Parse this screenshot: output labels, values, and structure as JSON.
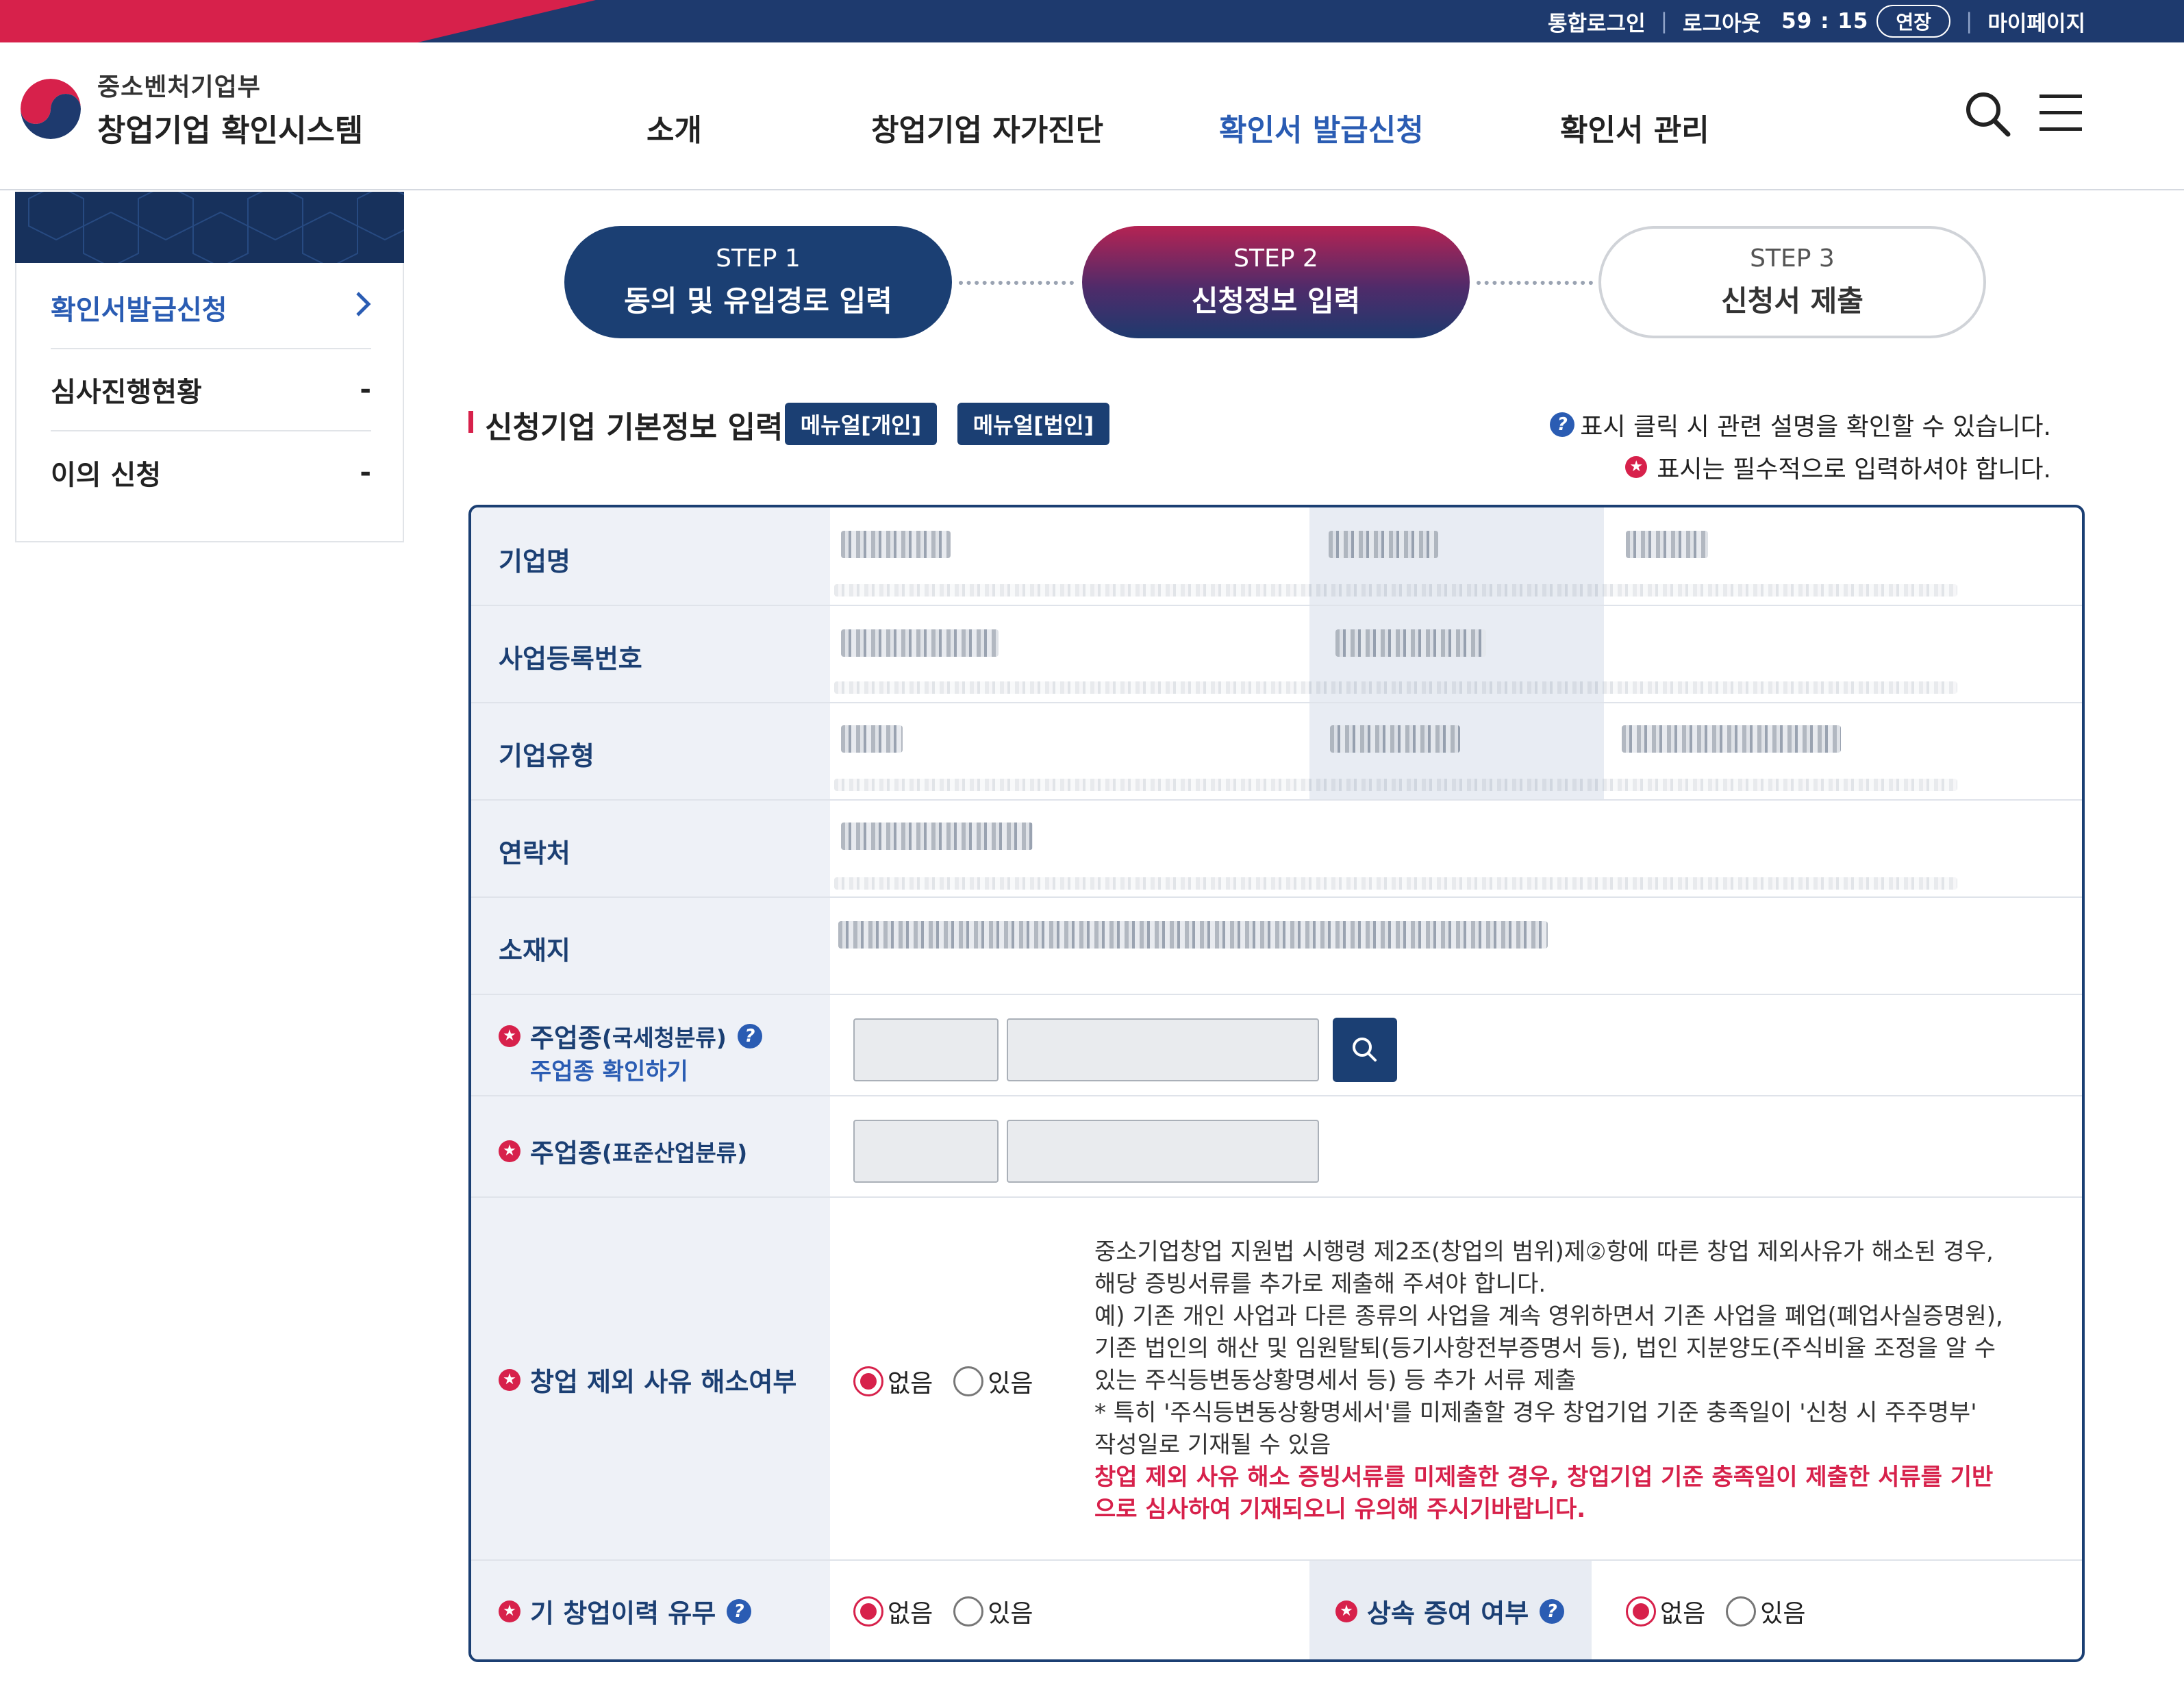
{
  "topbar": {
    "integrated_login": "통합로그인",
    "logout": "로그아웃",
    "timer": "59 : 15",
    "extend": "연장",
    "mypage": "마이페이지"
  },
  "logo": {
    "ministry": "중소벤처기업부",
    "system": "창업기업 확인시스템"
  },
  "gnb": {
    "items": [
      "소개",
      "창업기업 자가진단",
      "확인서 발급신청",
      "확인서 관리"
    ],
    "active_index": 2
  },
  "sidenav": {
    "items": [
      {
        "label": "확인서발급신청",
        "marker": "›"
      },
      {
        "label": "심사진행현황",
        "marker": "-"
      },
      {
        "label": "이의 신청",
        "marker": "-"
      }
    ]
  },
  "steps": [
    {
      "num": "STEP 1",
      "label": "동의 및 유입경로 입력",
      "state": "done"
    },
    {
      "num": "STEP 2",
      "label": "신청정보 입력",
      "state": "current"
    },
    {
      "num": "STEP 3",
      "label": "신청서 제출",
      "state": "todo"
    }
  ],
  "section": {
    "title": "신청기업 기본정보 입력",
    "manual_personal": "메뉴얼[개인]",
    "manual_corp": "메뉴얼[법인]",
    "notice_help": "표시 클릭 시 관련 설명을 확인할 수 있습니다.",
    "notice_required": "표시는 필수적으로 입력하셔야 합니다."
  },
  "form": {
    "company_name": "기업명",
    "biz_reg_no": "사업등록번호",
    "company_type": "기업유형",
    "contact": "연락처",
    "address": "소재지",
    "main_industry_nts": "주업종",
    "main_industry_nts_sub": "(국세청분류)",
    "check_industry_link": "주업종 확인하기",
    "main_industry_ksic": "주업종",
    "main_industry_ksic_sub": "(표준산업분류)",
    "exclusion_resolved": "창업 제외 사유 해소여부",
    "prior_startup": "기 창업이력 유무",
    "inheritance_gift": "상속 증여 여부",
    "option_no": "없음",
    "option_yes": "있음",
    "desc_lines": [
      "중소기업창업 지원법 시행령 제2조(창업의 범위)제②항에 따른 창업 제외사유가 해소된 경우,",
      "해당 증빙서류를 추가로 제출해 주셔야 합니다.",
      "예) 기존 개인 사업과 다른 종류의 사업을 계속 영위하면서 기존 사업을 폐업(폐업사실증명원),",
      "기존 법인의 해산 및 임원탈퇴(등기사항전부증명서 등), 법인 지분양도(주식비율 조정을 알 수",
      "있는 주식등변동상황명세서 등) 등 추가 서류 제출",
      "* 특히 '주식등변동상황명세서'를 미제출할 경우 창업기업 기준 충족일이 '신청 시 주주명부'",
      "작성일로 기재될 수 있음"
    ],
    "desc_warning_lines": [
      "창업 제외 사유 해소 증빙서류를 미제출한 경우, 창업기업 기준 충족일이 제출한 서류를 기반",
      "으로 심사하여 기재되오니 유의해 주시기바랍니다."
    ]
  },
  "colors": {
    "navy": "#1b3f73",
    "accent_red": "#d7214b",
    "link_blue": "#2a5cb3"
  },
  "icons": [
    "search-icon",
    "hamburger-menu-icon",
    "help-question-icon",
    "required-star-icon",
    "chevron-right-icon"
  ]
}
